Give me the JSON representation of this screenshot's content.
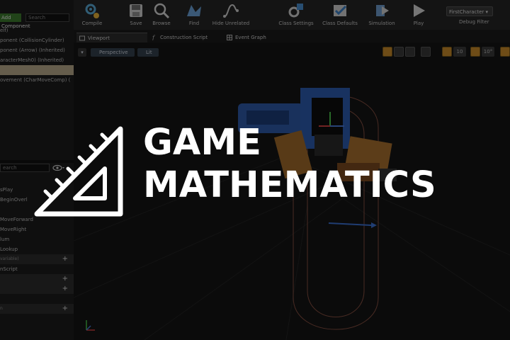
{
  "toolbar": {
    "buttons": [
      {
        "label": "Compile",
        "icon": "compile-icon"
      },
      {
        "label": "Save",
        "icon": "save-icon"
      },
      {
        "label": "Browse",
        "icon": "browse-icon"
      },
      {
        "label": "Find",
        "icon": "find-icon"
      },
      {
        "label": "Hide Unrelated",
        "icon": "hide-unrelated-icon"
      },
      {
        "label": "Class Settings",
        "icon": "class-settings-icon"
      },
      {
        "label": "Class Defaults",
        "icon": "class-defaults-icon"
      },
      {
        "label": "Simulation",
        "icon": "simulation-icon"
      },
      {
        "label": "Play",
        "icon": "play-icon"
      }
    ],
    "debug_filter_value": "FirstCharacter",
    "debug_filter_label": "Debug Filter"
  },
  "components_panel": {
    "add_label": "Add Component",
    "search_placeholder": "Search",
    "items": [
      {
        "label": "elf)",
        "selected": false
      },
      {
        "label": "ponent (CollisionCylinder)",
        "selected": false
      },
      {
        "label": "ponent (Arrow) (Inherited)",
        "selected": false
      },
      {
        "label": "aracterMesh0) (Inherited)",
        "selected": false
      },
      {
        "label": "",
        "selected": true
      },
      {
        "label": "ovement (CharMoveComp) (",
        "selected": false
      }
    ]
  },
  "my_blueprint_panel": {
    "search_placeholder": "earch",
    "items": [
      {
        "label": "",
        "type": "item"
      },
      {
        "label": "sPlay",
        "type": "item"
      },
      {
        "label": "BeginOverl",
        "type": "item"
      },
      {
        "label": "",
        "type": "item"
      },
      {
        "label": "MoveForward",
        "type": "item"
      },
      {
        "label": "MoveRight",
        "type": "item"
      },
      {
        "label": "lum",
        "type": "item"
      },
      {
        "label": "Lookup",
        "type": "item"
      },
      {
        "label": "variable)",
        "type": "section",
        "plus": "+"
      },
      {
        "label": "nScript",
        "type": "item"
      },
      {
        "label": "",
        "type": "section",
        "plus": "+"
      },
      {
        "label": "",
        "type": "section",
        "plus": "+"
      },
      {
        "label": "",
        "type": "item"
      },
      {
        "label": "n",
        "type": "section",
        "plus": "+"
      }
    ]
  },
  "tabs": [
    {
      "label": "Viewport",
      "active": true
    },
    {
      "label": "Construction Script",
      "active": false
    },
    {
      "label": "Event Graph",
      "active": false
    }
  ],
  "viewport": {
    "perspective_label": "Perspective",
    "lit_label": "Lit",
    "snap_values": [
      "10",
      "10°"
    ]
  },
  "overlay": {
    "line1": "GAME",
    "line2": "MATHEMATICS",
    "logo_icon": "triangle-ruler-icon"
  },
  "colors": {
    "accent_orange": "#c98a2a",
    "add_green": "#3d7a2e",
    "selected_row": "#b9a98a"
  }
}
